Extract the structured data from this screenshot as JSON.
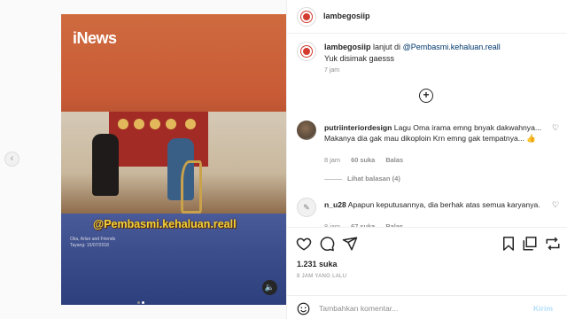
{
  "post": {
    "username": "lambegosiip",
    "brand_color": "#d33b2f"
  },
  "media": {
    "channel_logo": "iNews",
    "watermark": "@Pembasmi.kehaluan.reall",
    "credit_line1": "Oka, Arlan and Friends",
    "credit_line2": "Tayang: 15/07/2018",
    "slide_count": 2,
    "active_slide": 2,
    "audio_icon": "speaker-icon"
  },
  "caption": {
    "username": "lambegosiip",
    "prefix": "lanjut di",
    "mention": "@Pembasmi.kehaluan.reall",
    "line2": "Yuk disimak gaesss",
    "time": "7 jam"
  },
  "comments": [
    {
      "username": "putriinteriordesign",
      "text": "Lagu Oma irama emng bnyak dakwahnya... Makanya dia gak mau dikoploin Krn emng gak tempatnya... 👍",
      "time": "8 jam",
      "likes": "60 suka",
      "reply": "Balas",
      "view_replies": "Lihat balasan (4)"
    },
    {
      "username": "n_u28",
      "text": "Apapun keputusannya, dia berhak atas semua karyanya.",
      "time": "8 jam",
      "likes": "67 suka",
      "reply": "Balas"
    }
  ],
  "actions": {
    "likes": "1.231 suka",
    "ago": "8 JAM YANG LALU"
  },
  "add_comment": {
    "placeholder": "Tambahkan komentar...",
    "post_label": "Kirim"
  }
}
